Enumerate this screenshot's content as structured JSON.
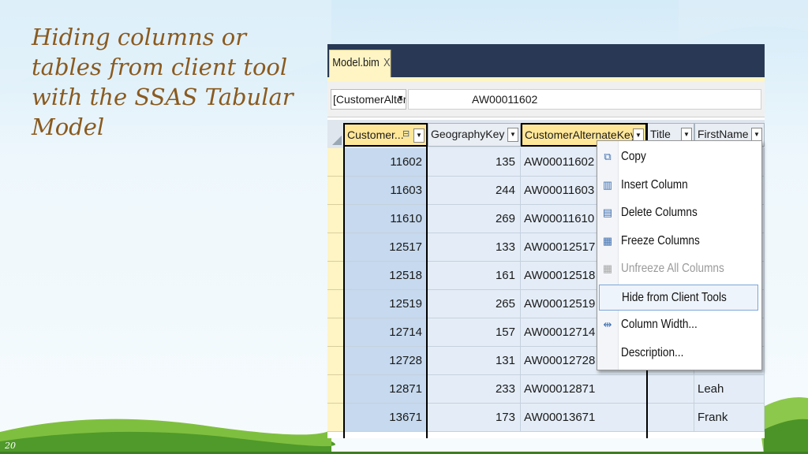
{
  "slide": {
    "title": "Hiding columns or tables from client tool with the SSAS Tabular Model",
    "page_number": "20"
  },
  "window": {
    "tab_label": "Model.bim",
    "tab_close": "X"
  },
  "filter": {
    "column_select": "[CustomerAltern",
    "formula_value": "AW00011602"
  },
  "table": {
    "columns": [
      "Customer...",
      "GeographyKey",
      "CustomerAlternateKey",
      "Title",
      "FirstName"
    ],
    "rows": [
      {
        "customer": "11602",
        "geo": "135",
        "alt": "AW00011602",
        "first": ""
      },
      {
        "customer": "11603",
        "geo": "244",
        "alt": "AW00011603",
        "first": ""
      },
      {
        "customer": "11610",
        "geo": "269",
        "alt": "AW00011610",
        "first": ""
      },
      {
        "customer": "12517",
        "geo": "133",
        "alt": "AW00012517",
        "first": ""
      },
      {
        "customer": "12518",
        "geo": "161",
        "alt": "AW00012518",
        "first": ""
      },
      {
        "customer": "12519",
        "geo": "265",
        "alt": "AW00012519",
        "first": ""
      },
      {
        "customer": "12714",
        "geo": "157",
        "alt": "AW00012714",
        "first": ""
      },
      {
        "customer": "12728",
        "geo": "131",
        "alt": "AW00012728",
        "first": ""
      },
      {
        "customer": "12871",
        "geo": "233",
        "alt": "AW00012871",
        "first": "Leah"
      },
      {
        "customer": "13671",
        "geo": "173",
        "alt": "AW00013671",
        "first": "Frank"
      }
    ]
  },
  "context_menu": {
    "items": [
      {
        "label": "Copy",
        "icon": "copy-icon",
        "enabled": true
      },
      {
        "label": "Insert Column",
        "icon": "insert-column-icon",
        "enabled": true
      },
      {
        "label": "Delete Columns",
        "icon": "delete-columns-icon",
        "enabled": true
      },
      {
        "label": "Freeze Columns",
        "icon": "freeze-columns-icon",
        "enabled": true
      },
      {
        "label": "Unfreeze All Columns",
        "icon": "unfreeze-columns-icon",
        "enabled": false
      },
      {
        "label": "Hide from Client Tools",
        "icon": "",
        "enabled": true,
        "highlighted": true
      },
      {
        "label": "Column Width...",
        "icon": "column-width-icon",
        "enabled": true
      },
      {
        "label": "Description...",
        "icon": "",
        "enabled": true
      }
    ]
  },
  "colors": {
    "title": "#8a5a1f",
    "tab_bar": "#293955",
    "selected_header": "#ffe799",
    "row_blue": "#c6d9ee"
  }
}
